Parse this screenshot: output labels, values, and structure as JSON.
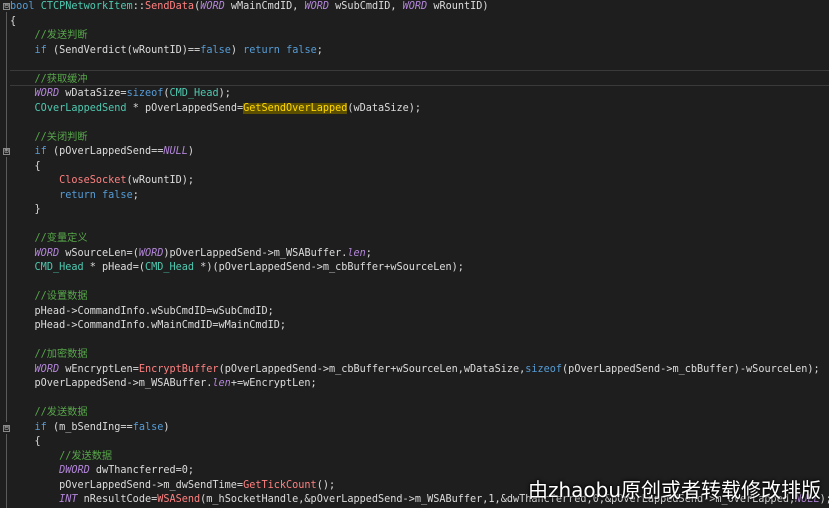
{
  "colors": {
    "background": "#1e1e1e",
    "keyword": "#569cd6",
    "type": "#4ec9b0",
    "macro": "#b386d9",
    "function": "#ff8080",
    "comment": "#57a64a",
    "text": "#dcdcdc",
    "highlight": "#ffd700"
  },
  "editor": {
    "fold_markers": [
      {
        "symbol": "⊟"
      },
      {
        "symbol": "⊟"
      },
      {
        "symbol": "⊟"
      }
    ],
    "lines": [
      [
        [
          "kw",
          "bool"
        ],
        [
          "txt",
          " "
        ],
        [
          "cls",
          "CTCPNetworkItem"
        ],
        [
          "txt",
          "::"
        ],
        [
          "fn",
          "SendData"
        ],
        [
          "txt",
          "("
        ],
        [
          "macro",
          "WORD"
        ],
        [
          "txt",
          " wMainCmdID, "
        ],
        [
          "macro",
          "WORD"
        ],
        [
          "txt",
          " wSubCmdID, "
        ],
        [
          "macro",
          "WORD"
        ],
        [
          "txt",
          " wRountID)"
        ]
      ],
      [
        [
          "txt",
          "{"
        ]
      ],
      [
        [
          "cmt",
          "    //发送判断"
        ]
      ],
      [
        [
          "txt",
          "    "
        ],
        [
          "kw",
          "if"
        ],
        [
          "txt",
          " ("
        ],
        [
          "txt",
          "SendVerdict"
        ],
        [
          "txt",
          "(wRountID)=="
        ],
        [
          "kw",
          "false"
        ],
        [
          "txt",
          ") "
        ],
        [
          "kw",
          "return"
        ],
        [
          "txt",
          " "
        ],
        [
          "kw",
          "false"
        ],
        [
          "txt",
          ";"
        ]
      ],
      [
        [
          "txt",
          ""
        ]
      ],
      [
        [
          "cmt",
          "    //获取缓冲"
        ]
      ],
      [
        [
          "txt",
          "    "
        ],
        [
          "macro",
          "WORD"
        ],
        [
          "txt",
          " wDataSize="
        ],
        [
          "kw",
          "sizeof"
        ],
        [
          "txt",
          "("
        ],
        [
          "ty",
          "CMD_Head"
        ],
        [
          "txt",
          ");"
        ]
      ],
      [
        [
          "txt",
          "    "
        ],
        [
          "ty",
          "COverLappedSend"
        ],
        [
          "txt",
          " * pOverLappedSend="
        ],
        [
          "hl",
          "GetSendOverLapped"
        ],
        [
          "txt",
          "(wDataSize);"
        ]
      ],
      [
        [
          "txt",
          ""
        ]
      ],
      [
        [
          "cmt",
          "    //关闭判断"
        ]
      ],
      [
        [
          "txt",
          "    "
        ],
        [
          "kw",
          "if"
        ],
        [
          "txt",
          " (pOverLappedSend=="
        ],
        [
          "macro",
          "NULL"
        ],
        [
          "txt",
          ")"
        ]
      ],
      [
        [
          "txt",
          "    {"
        ]
      ],
      [
        [
          "txt",
          "        "
        ],
        [
          "fn",
          "CloseSocket"
        ],
        [
          "txt",
          "(wRountID);"
        ]
      ],
      [
        [
          "txt",
          "        "
        ],
        [
          "kw",
          "return"
        ],
        [
          "txt",
          " "
        ],
        [
          "kw",
          "false"
        ],
        [
          "txt",
          ";"
        ]
      ],
      [
        [
          "txt",
          "    }"
        ]
      ],
      [
        [
          "txt",
          ""
        ]
      ],
      [
        [
          "cmt",
          "    //变量定义"
        ]
      ],
      [
        [
          "txt",
          "    "
        ],
        [
          "macro",
          "WORD"
        ],
        [
          "txt",
          " wSourceLen=("
        ],
        [
          "macro",
          "WORD"
        ],
        [
          "txt",
          ")pOverLappedSend->"
        ],
        [
          "mem",
          "m_WSABuffer"
        ],
        [
          "txt",
          "."
        ],
        [
          "macro",
          "len"
        ],
        [
          "txt",
          ";"
        ]
      ],
      [
        [
          "txt",
          "    "
        ],
        [
          "ty",
          "CMD_Head"
        ],
        [
          "txt",
          " * pHead=("
        ],
        [
          "ty",
          "CMD_Head"
        ],
        [
          "txt",
          " *)(pOverLappedSend->m_cbBuffer+wSourceLen);"
        ]
      ],
      [
        [
          "txt",
          ""
        ]
      ],
      [
        [
          "cmt",
          "    //设置数据"
        ]
      ],
      [
        [
          "txt",
          "    pHead->CommandInfo.wSubCmdID=wSubCmdID;"
        ]
      ],
      [
        [
          "txt",
          "    pHead->CommandInfo.wMainCmdID=wMainCmdID;"
        ]
      ],
      [
        [
          "txt",
          ""
        ]
      ],
      [
        [
          "cmt",
          "    //加密数据"
        ]
      ],
      [
        [
          "txt",
          "    "
        ],
        [
          "macro",
          "WORD"
        ],
        [
          "txt",
          " wEncryptLen="
        ],
        [
          "fn",
          "EncryptBuffer"
        ],
        [
          "txt",
          "(pOverLappedSend->m_cbBuffer+wSourceLen,wDataSize,"
        ],
        [
          "kw",
          "sizeof"
        ],
        [
          "txt",
          "(pOverLappedSend->m_cbBuffer)-wSourceLen);"
        ]
      ],
      [
        [
          "txt",
          "    pOverLappedSend->m_WSABuffer."
        ],
        [
          "macro",
          "len"
        ],
        [
          "txt",
          "+=wEncryptLen;"
        ]
      ],
      [
        [
          "txt",
          ""
        ]
      ],
      [
        [
          "cmt",
          "    //发送数据"
        ]
      ],
      [
        [
          "txt",
          "    "
        ],
        [
          "kw",
          "if"
        ],
        [
          "txt",
          " (m_bSendIng=="
        ],
        [
          "kw",
          "false"
        ],
        [
          "txt",
          ")"
        ]
      ],
      [
        [
          "txt",
          "    {"
        ]
      ],
      [
        [
          "cmt",
          "        //发送数据"
        ]
      ],
      [
        [
          "txt",
          "        "
        ],
        [
          "macro",
          "DWORD"
        ],
        [
          "txt",
          " dwThancferred=0;"
        ]
      ],
      [
        [
          "txt",
          "        pOverLappedSend->m_dwSendTime="
        ],
        [
          "fn",
          "GetTickCount"
        ],
        [
          "txt",
          "();"
        ]
      ],
      [
        [
          "txt",
          "        "
        ],
        [
          "macro",
          "INT"
        ],
        [
          "txt",
          " nResultCode="
        ],
        [
          "fn",
          "WSASend"
        ],
        [
          "txt",
          "(m_hSocketHandle,&pOverLappedSend->m_WSABuffer,1,&dwThancferred,0,&pOverLappedSend->m_OverLapped,"
        ],
        [
          "macro",
          "NULL"
        ],
        [
          "txt",
          ");"
        ]
      ]
    ]
  },
  "watermark": {
    "text": "由zhaobu原创或者转载修改排版"
  }
}
